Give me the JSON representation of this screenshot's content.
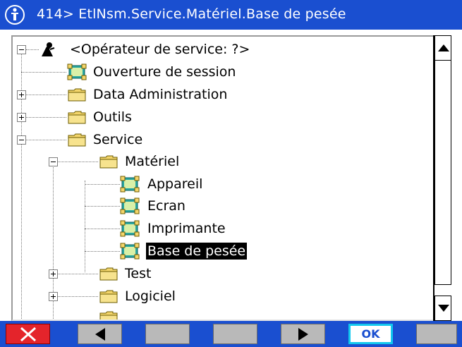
{
  "window": {
    "title": "414> EtlNsm.Service.Matériel.Base de pesée"
  },
  "tree": {
    "nodes": [
      {
        "label": "<Opérateur de service: ?>",
        "icon": "user-icon",
        "expander": "minus"
      },
      {
        "label": "Ouverture de session",
        "icon": "module-icon",
        "expander": "none"
      },
      {
        "label": "Data Administration",
        "icon": "folder-icon",
        "expander": "plus"
      },
      {
        "label": "Outils",
        "icon": "folder-icon",
        "expander": "plus"
      },
      {
        "label": "Service",
        "icon": "folder-icon",
        "expander": "minus"
      },
      {
        "label": "Matériel",
        "icon": "folder-icon",
        "expander": "minus"
      },
      {
        "label": "Appareil",
        "icon": "module-icon",
        "expander": "none"
      },
      {
        "label": "Ecran",
        "icon": "module-icon",
        "expander": "none"
      },
      {
        "label": "Imprimante",
        "icon": "module-icon",
        "expander": "none"
      },
      {
        "label": "Base de pesée",
        "icon": "module-icon",
        "expander": "none",
        "selected": true
      },
      {
        "label": "Test",
        "icon": "folder-icon",
        "expander": "plus"
      },
      {
        "label": "Logiciel",
        "icon": "folder-icon",
        "expander": "plus"
      }
    ]
  },
  "softkeys": [
    {
      "icon": "cancel-x-icon",
      "color": "#e4242b"
    },
    {
      "icon": "arrow-left-icon"
    },
    {
      "icon": "blank"
    },
    {
      "icon": "blank"
    },
    {
      "icon": "arrow-right-icon"
    },
    {
      "label": "OK",
      "color": "#12c7ee"
    },
    {
      "icon": "blank"
    }
  ],
  "colors": {
    "titlebar": "#1a4fd0",
    "selection": "#000000",
    "folder": "#f3d56b",
    "module": "#2aa7a0"
  }
}
